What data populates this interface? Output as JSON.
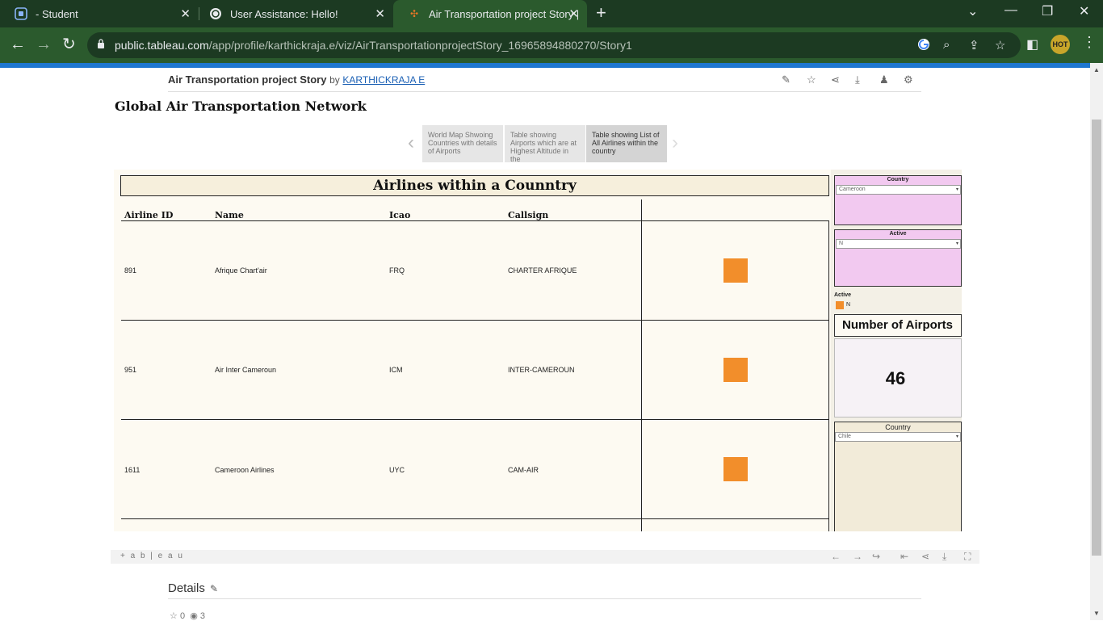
{
  "browser": {
    "tabs": [
      {
        "title": "- Student",
        "icon": "student-portal-icon"
      },
      {
        "title": "User Assistance: Hello!",
        "icon": "chatgpt-icon"
      },
      {
        "title": "Air Transportation project Story |",
        "icon": "tableau-icon",
        "active": true
      }
    ],
    "new_tab_label": "+",
    "url_host": "public.tableau.com",
    "url_path": "/app/profile/karthickraja.e/viz/AirTransportationprojectStory_16965894880270/Story1"
  },
  "viz_header": {
    "title": "Air Transportation project Story",
    "by": "by",
    "author": "KARTHICKRAJA E"
  },
  "story": {
    "title": "Global Air Transportation Network",
    "nav_points": [
      "World Map Shwoing Countries with details of Airports",
      "Table showing Airports which are at Highest Altitude in the",
      "Table showing List of All Airlines within the country"
    ]
  },
  "table": {
    "title": "Airlines within a Counntry",
    "columns": [
      "Airline ID",
      "Name",
      "Icao",
      "Callsign"
    ],
    "rows": [
      {
        "id": "891",
        "name": "Afrique Chart'air",
        "icao": "FRQ",
        "callsign": "CHARTER AFRIQUE"
      },
      {
        "id": "951",
        "name": "Air Inter Cameroun",
        "icao": "ICM",
        "callsign": "INTER-CAMEROUN"
      },
      {
        "id": "1611",
        "name": "Cameroon Airlines",
        "icao": "UYC",
        "callsign": "CAM-AIR"
      }
    ],
    "marker_color": "#f28e2b"
  },
  "filters": {
    "country": {
      "title": "Country",
      "value": "Cameroon"
    },
    "active": {
      "title": "Active",
      "value": "N"
    },
    "legend_title": "Active",
    "legend_item": "N",
    "country2": {
      "title": "Country",
      "value": "Chile"
    }
  },
  "kpi": {
    "title": "Number of Airports",
    "value": "46"
  },
  "footer": {
    "logo": "+ a b | e a u",
    "details_label": "Details",
    "favorites": "0",
    "views": "3"
  },
  "colors": {
    "tabbar": "#1c3a22",
    "toolbar": "#2b5a2d",
    "accent_blue": "#1f77d0",
    "filter_pink": "#f2c9f0",
    "marker_orange": "#f28e2b"
  }
}
